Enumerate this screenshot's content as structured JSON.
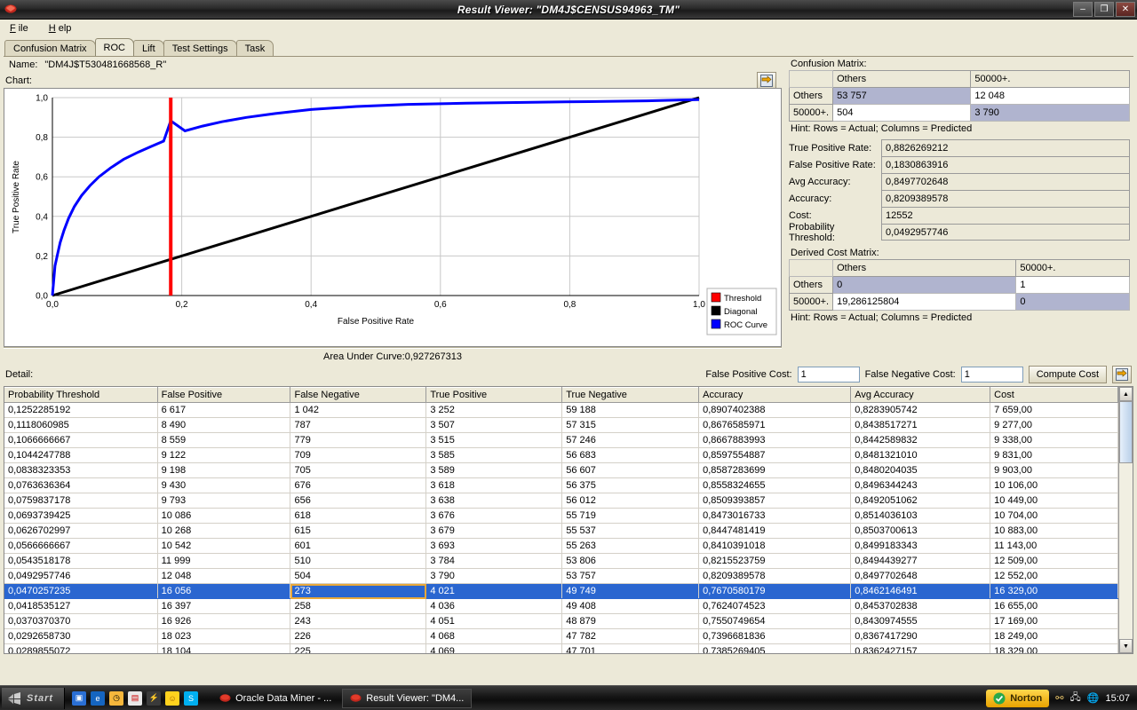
{
  "window": {
    "title": "Result Viewer: \"DM4J$CENSUS94963_TM\"",
    "icon": "oracle-gem-icon",
    "minimize_label": "–",
    "maximize_label": "❐",
    "close_label": "✕"
  },
  "menu": {
    "items": [
      {
        "label": "File"
      },
      {
        "label": "Help"
      }
    ]
  },
  "tabs": [
    {
      "label": "Confusion Matrix",
      "active": false
    },
    {
      "label": "ROC",
      "active": true
    },
    {
      "label": "Lift",
      "active": false
    },
    {
      "label": "Test Settings",
      "active": false
    },
    {
      "label": "Task",
      "active": false
    }
  ],
  "name_row": {
    "label": "Name:",
    "value": "\"DM4J$T530481668568_R\""
  },
  "chart_label": "Chart:",
  "export_icon": "export-arrow-icon",
  "auc_label": "Area Under Curve:0,927267313",
  "chart_data": {
    "type": "line",
    "title": "",
    "xlabel": "False Positive Rate",
    "ylabel": "True Positive Rate",
    "xlim": [
      0,
      1
    ],
    "ylim": [
      0,
      1
    ],
    "xticks": [
      "0,0",
      "0,2",
      "0,4",
      "0,6",
      "0,8",
      "1,0"
    ],
    "yticks": [
      "0,0",
      "0,2",
      "0,4",
      "0,6",
      "0,8",
      "1,0"
    ],
    "grid": true,
    "legend_position": "right",
    "legend": [
      {
        "label": "Threshold",
        "color": "#ff0000"
      },
      {
        "label": "Diagonal",
        "color": "#000000"
      },
      {
        "label": "ROC Curve",
        "color": "#0000ff"
      }
    ],
    "series": [
      {
        "name": "ROC Curve",
        "color": "#0000ff",
        "points": [
          [
            0.0,
            0.0
          ],
          [
            0.002,
            0.075
          ],
          [
            0.004,
            0.15
          ],
          [
            0.008,
            0.21
          ],
          [
            0.012,
            0.268
          ],
          [
            0.018,
            0.33
          ],
          [
            0.025,
            0.39
          ],
          [
            0.034,
            0.45
          ],
          [
            0.045,
            0.505
          ],
          [
            0.058,
            0.555
          ],
          [
            0.072,
            0.6
          ],
          [
            0.09,
            0.645
          ],
          [
            0.11,
            0.688
          ],
          [
            0.133,
            0.725
          ],
          [
            0.152,
            0.752
          ],
          [
            0.172,
            0.78
          ],
          [
            0.183,
            0.8826
          ],
          [
            0.205,
            0.832
          ],
          [
            0.232,
            0.856
          ],
          [
            0.262,
            0.878
          ],
          [
            0.3,
            0.9
          ],
          [
            0.345,
            0.92
          ],
          [
            0.4,
            0.94
          ],
          [
            0.47,
            0.955
          ],
          [
            0.55,
            0.966
          ],
          [
            0.64,
            0.972
          ],
          [
            0.73,
            0.976
          ],
          [
            0.83,
            0.98
          ],
          [
            0.92,
            0.984
          ],
          [
            1.0,
            0.99
          ]
        ]
      },
      {
        "name": "Diagonal",
        "color": "#000000",
        "points": [
          [
            0.0,
            0.0
          ],
          [
            1.0,
            1.0
          ]
        ]
      },
      {
        "name": "Threshold",
        "color": "#ff0000",
        "x": 0.183
      }
    ]
  },
  "confusion_matrix": {
    "label": "Confusion Matrix:",
    "columns": [
      "",
      "Others",
      "50000+."
    ],
    "rows": [
      {
        "header": "Others",
        "cells": [
          "53 757",
          "12 048"
        ],
        "diagonal_index": 0
      },
      {
        "header": "50000+.",
        "cells": [
          "504",
          "3 790"
        ],
        "diagonal_index": 1
      }
    ],
    "hint": "Hint: Rows = Actual; Columns = Predicted"
  },
  "metrics": [
    {
      "label": "True Positive Rate:",
      "value": "0,8826269212"
    },
    {
      "label": "False Positive Rate:",
      "value": "0,1830863916"
    },
    {
      "label": "Avg Accuracy:",
      "value": "0,8497702648"
    },
    {
      "label": "Accuracy:",
      "value": "0,8209389578"
    },
    {
      "label": "Cost:",
      "value": "12552"
    },
    {
      "label": "Probability Threshold:",
      "value": "0,0492957746"
    }
  ],
  "derived_cost_matrix": {
    "label": "Derived Cost Matrix:",
    "columns": [
      "",
      "Others",
      "50000+."
    ],
    "rows": [
      {
        "header": "Others",
        "cells": [
          "0",
          "1"
        ],
        "diagonal_index": 0
      },
      {
        "header": "50000+.",
        "cells": [
          "19,286125804",
          "0"
        ],
        "diagonal_index": 1
      }
    ],
    "hint": "Hint: Rows = Actual; Columns = Predicted"
  },
  "detail": {
    "label": "Detail:",
    "false_positive_cost_label": "False Positive Cost:",
    "false_positive_cost_value": "1",
    "false_negative_cost_label": "False Negative Cost:",
    "false_negative_cost_value": "1",
    "compute_cost_label": "Compute Cost",
    "export_icon": "export-arrow-icon"
  },
  "table": {
    "columns": [
      "Probability Threshold",
      "False Positive",
      "False Negative",
      "True Positive",
      "True Negative",
      "Accuracy",
      "Avg Accuracy",
      "Cost"
    ],
    "selected_row_index": 12,
    "focused_cell_column_index": 2,
    "rows": [
      [
        "0,1252285192",
        "6 617",
        "1 042",
        "3 252",
        "59 188",
        "0,8907402388",
        "0,8283905742",
        "7 659,00"
      ],
      [
        "0,1118060985",
        "8 490",
        "787",
        "3 507",
        "57 315",
        "0,8676585971",
        "0,8438517271",
        "9 277,00"
      ],
      [
        "0,1066666667",
        "8 559",
        "779",
        "3 515",
        "57 246",
        "0,8667883993",
        "0,8442589832",
        "9 338,00"
      ],
      [
        "0,1044247788",
        "9 122",
        "709",
        "3 585",
        "56 683",
        "0,8597554887",
        "0,8481321010",
        "9 831,00"
      ],
      [
        "0,0838323353",
        "9 198",
        "705",
        "3 589",
        "56 607",
        "0,8587283699",
        "0,8480204035",
        "9 903,00"
      ],
      [
        "0,0763636364",
        "9 430",
        "676",
        "3 618",
        "56 375",
        "0,8558324655",
        "0,8496344243",
        "10 106,00"
      ],
      [
        "0,0759837178",
        "9 793",
        "656",
        "3 638",
        "56 012",
        "0,8509393857",
        "0,8492051062",
        "10 449,00"
      ],
      [
        "0,0693739425",
        "10 086",
        "618",
        "3 676",
        "55 719",
        "0,8473016733",
        "0,8514036103",
        "10 704,00"
      ],
      [
        "0,0626702997",
        "10 268",
        "615",
        "3 679",
        "55 537",
        "0,8447481419",
        "0,8503700613",
        "10 883,00"
      ],
      [
        "0,0566666667",
        "10 542",
        "601",
        "3 693",
        "55 263",
        "0,8410391018",
        "0,8499183343",
        "11 143,00"
      ],
      [
        "0,0543518178",
        "11 999",
        "510",
        "3 784",
        "53 806",
        "0,8215523759",
        "0,8494439277",
        "12 509,00"
      ],
      [
        "0,0492957746",
        "12 048",
        "504",
        "3 790",
        "53 757",
        "0,8209389578",
        "0,8497702648",
        "12 552,00"
      ],
      [
        "0,0470257235",
        "16 056",
        "273",
        "4 021",
        "49 749",
        "0,7670580179",
        "0,8462146491",
        "16 329,00"
      ],
      [
        "0,0418535127",
        "16 397",
        "258",
        "4 036",
        "49 408",
        "0,7624074523",
        "0,8453702838",
        "16 655,00"
      ],
      [
        "0,0370370370",
        "16 926",
        "243",
        "4 051",
        "48 879",
        "0,7550749654",
        "0,8430974555",
        "17 169,00"
      ],
      [
        "0,0292658730",
        "18 023",
        "226",
        "4 068",
        "47 782",
        "0,7396681836",
        "0,8367417290",
        "18 249,00"
      ],
      [
        "0,0289855072",
        "18 104",
        "225",
        "4 069",
        "47 701",
        "0,7385269405",
        "0,8362427157",
        "18 329,00"
      ]
    ]
  },
  "taskbar": {
    "start_label": "Start",
    "quick_launch": [
      {
        "name": "media-icon"
      },
      {
        "name": "internet-explorer-icon"
      },
      {
        "name": "clock-icon"
      },
      {
        "name": "save-icon"
      },
      {
        "name": "lightning-icon"
      },
      {
        "name": "smiley-icon"
      },
      {
        "name": "skype-icon"
      }
    ],
    "tasks": [
      {
        "label": "Oracle Data Miner - ...",
        "active": false,
        "icon": "oracle-gem-icon"
      },
      {
        "label": "Result Viewer: \"DM4...",
        "active": true,
        "icon": "oracle-gem-icon"
      }
    ],
    "norton_label": "Norton",
    "tray_icons": [
      "usb-icon",
      "network-icon",
      "globe-icon"
    ],
    "clock": "15:07"
  },
  "colors": {
    "roc_curve": "#0000ff",
    "diagonal": "#000000",
    "threshold": "#ff0000",
    "selection": "#2a66d0",
    "focus_outline": "#e9a83a",
    "diagonal_cell": "#b0b4cf",
    "window_chrome": "#ece9d8"
  }
}
